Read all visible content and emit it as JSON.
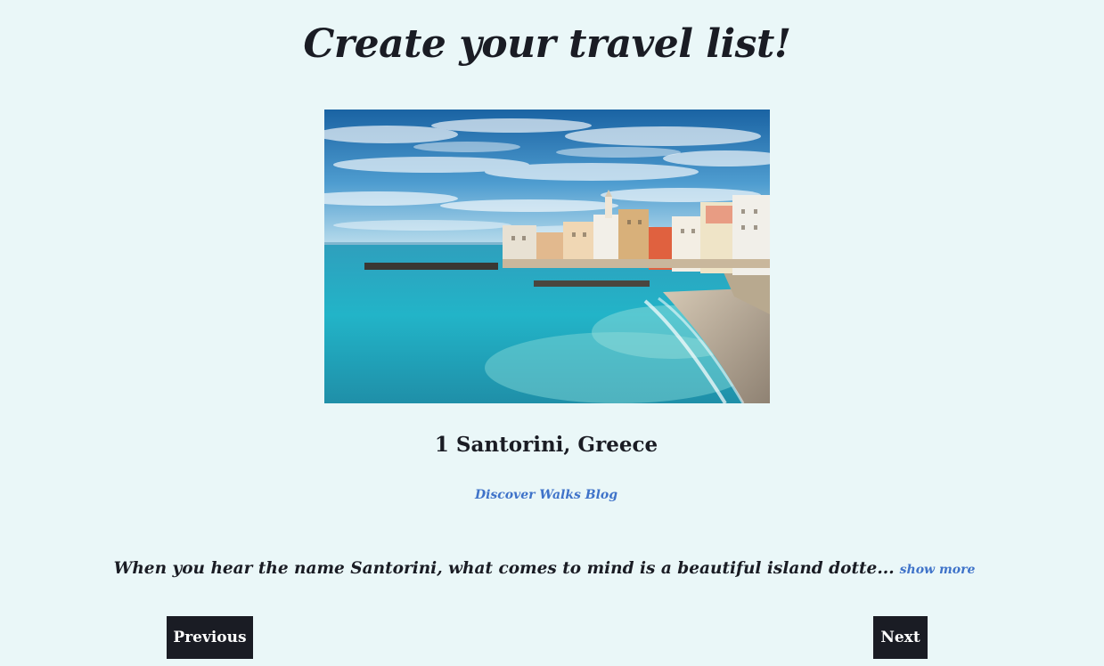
{
  "page": {
    "title": "Create your travel list!"
  },
  "destination": {
    "heading": "1 Santorini, Greece",
    "source_link": "Discover Walks Blog",
    "description": "When you hear the name Santorini, what comes to mind is a beautiful island dotte...",
    "show_more": "show more"
  },
  "navigation": {
    "previous_label": "Previous",
    "next_label": "Next"
  },
  "colors": {
    "background": "#eaf7f8",
    "text": "#1a1c24",
    "link": "#3f73c9",
    "button_bg": "#1a1c24",
    "button_text": "#ffffff"
  }
}
